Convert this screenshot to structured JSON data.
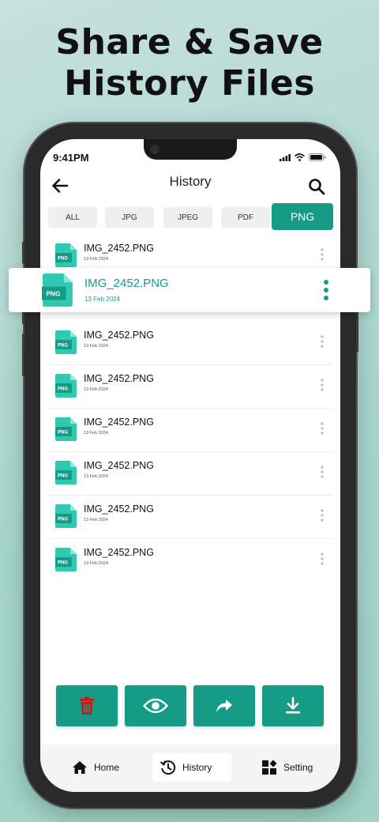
{
  "headline": {
    "line1": "Share & Save",
    "line2": "History Files"
  },
  "status_bar": {
    "time": "9:41PM"
  },
  "app_bar": {
    "title": "History"
  },
  "filter_tabs": [
    {
      "label": "ALL"
    },
    {
      "label": "JPG"
    },
    {
      "label": "JPEG"
    },
    {
      "label": "PDF"
    },
    {
      "label": "PNG",
      "selected": true
    }
  ],
  "file_badge": "PNG",
  "files": [
    {
      "name": "IMG_2452.PNG",
      "date": "13 Feb 2024"
    },
    {
      "name": "IMG_2452.PNG",
      "date": "13 Feb 2024",
      "highlighted": true
    },
    {
      "name": "IMG_2452.PNG",
      "date": "13 Feb 2024"
    },
    {
      "name": "IMG_2452.PNG",
      "date": "13 Feb 2024"
    },
    {
      "name": "IMG_2452.PNG",
      "date": "13 Feb 2024"
    },
    {
      "name": "IMG_2452.PNG",
      "date": "13 Feb 2024"
    },
    {
      "name": "IMG_2452.PNG",
      "date": "13 Feb 2024"
    },
    {
      "name": "IMG_2452.PNG",
      "date": "13 Feb 2024"
    }
  ],
  "actions": [
    "delete-icon",
    "eye-icon",
    "share-icon",
    "download-icon"
  ],
  "bottom_nav": [
    {
      "label": "Home",
      "icon": "home-icon"
    },
    {
      "label": "History",
      "icon": "history-icon",
      "active": true
    },
    {
      "label": "Setting",
      "icon": "settings-icon"
    }
  ],
  "colors": {
    "accent": "#169b86",
    "file_icon": "#2ec9b0",
    "delete": "#c0201c",
    "background": "#a8d6cd"
  }
}
